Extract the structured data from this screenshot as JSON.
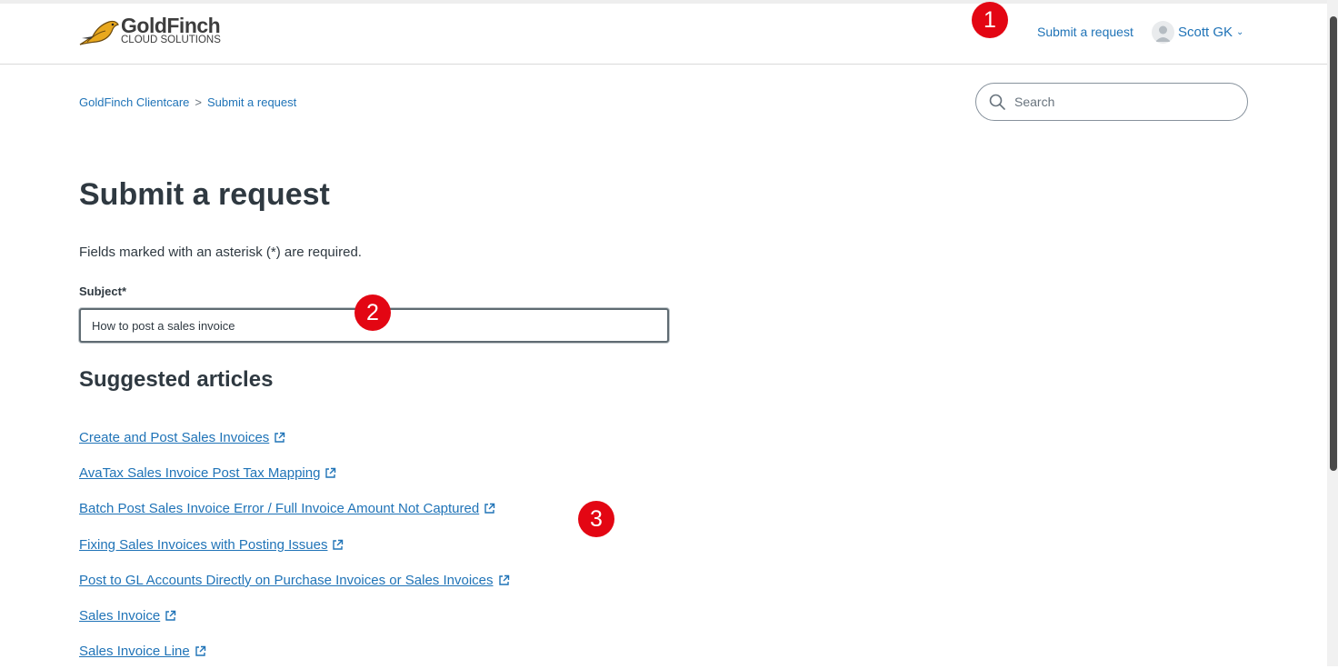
{
  "header": {
    "logo_title": "GoldFinch",
    "logo_subtitle": "CLOUD SOLUTIONS",
    "submit_link": "Submit a request",
    "user_name": "Scott GK",
    "user_menu_icon": "chevron-down-icon"
  },
  "breadcrumb": {
    "items": [
      "GoldFinch Clientcare",
      "Submit a request"
    ],
    "separator": ">"
  },
  "search": {
    "placeholder": "Search"
  },
  "page": {
    "title": "Submit a request",
    "required_note": "Fields marked with an asterisk (*) are required."
  },
  "form": {
    "subject_label": "Subject*",
    "subject_value": "How to post a sales invoice"
  },
  "suggested": {
    "heading": "Suggested articles",
    "articles": [
      "Create and Post Sales Invoices",
      "AvaTax Sales Invoice Post Tax Mapping",
      "Batch Post Sales Invoice Error / Full Invoice Amount Not Captured",
      "Fixing Sales Invoices with Posting Issues",
      "Post to GL Accounts Directly on Purchase Invoices or Sales Invoices",
      "Sales Invoice",
      "Sales Invoice Line"
    ]
  },
  "markers": [
    "1",
    "2",
    "3"
  ],
  "colors": {
    "link": "#1f73b7",
    "text": "#2f3941",
    "marker": "#e30613",
    "logo_bird": "#e8a81e"
  }
}
